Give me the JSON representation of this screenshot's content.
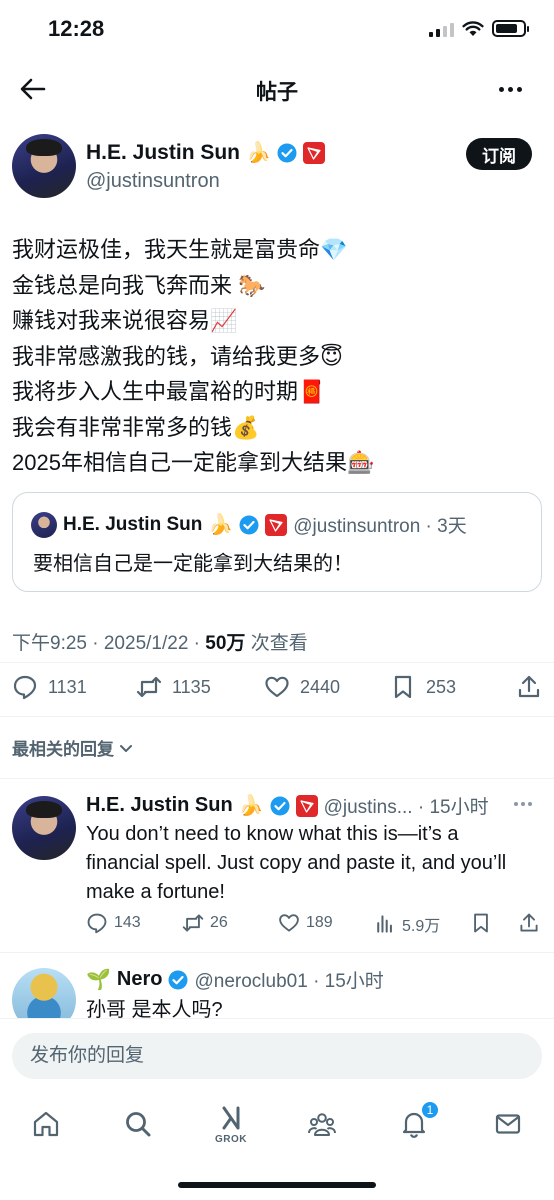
{
  "status_bar": {
    "time": "12:28"
  },
  "header": {
    "title": "帖子"
  },
  "post": {
    "author_name": "H.E. Justin Sun",
    "author_emoji": "🍌",
    "handle": "@justinsuntron",
    "subscribe_label": "订阅",
    "lines": [
      "我财运极佳，我天生就是富贵命💎",
      "金钱总是向我飞奔而来 🐎",
      "赚钱对我来说很容易📈",
      "我非常感激我的钱，请给我更多😇",
      "我将步入人生中最富裕的时期🧧",
      "我会有非常非常多的钱💰",
      "2025年相信自己一定能拿到大结果🎰"
    ],
    "quote": {
      "author_name": "H.E. Justin Sun",
      "author_emoji": "🍌",
      "handle_time": "@justinsuntron · 3天",
      "text": "要相信自己是一定能拿到大结果的！"
    },
    "meta_time": "下午9:25 · 2025/1/22 · ",
    "views_count": "50万",
    "views_label": " 次查看",
    "stats": {
      "replies": "1131",
      "reposts": "1135",
      "likes": "2440",
      "bookmarks": "253"
    }
  },
  "reply_sort": {
    "label": "最相关的回复"
  },
  "replies": [
    {
      "author_name": "H.E. Justin Sun",
      "author_emoji": "🍌",
      "handle_time": "@justins... · 15小时",
      "text": "You don’t need to know what this is—it’s a financial spell. Just copy and paste it, and you’ll make a fortune!",
      "replies": "143",
      "reposts": "26",
      "likes": "189",
      "views": "5.9万"
    },
    {
      "author_name": "Nero",
      "author_emoji": "🌱",
      "handle_time": "@neroclub01 · 15小时",
      "text": "孙哥 是本人吗?"
    }
  ],
  "reply_box": {
    "placeholder": "发布你的回复"
  },
  "tab_bar": {
    "grok_label": "GROK",
    "notification_count": "1"
  },
  "colors": {
    "accent": "#1d9bf0",
    "text": "#0f1419",
    "muted": "#536471",
    "tron_red": "#e0272a"
  }
}
